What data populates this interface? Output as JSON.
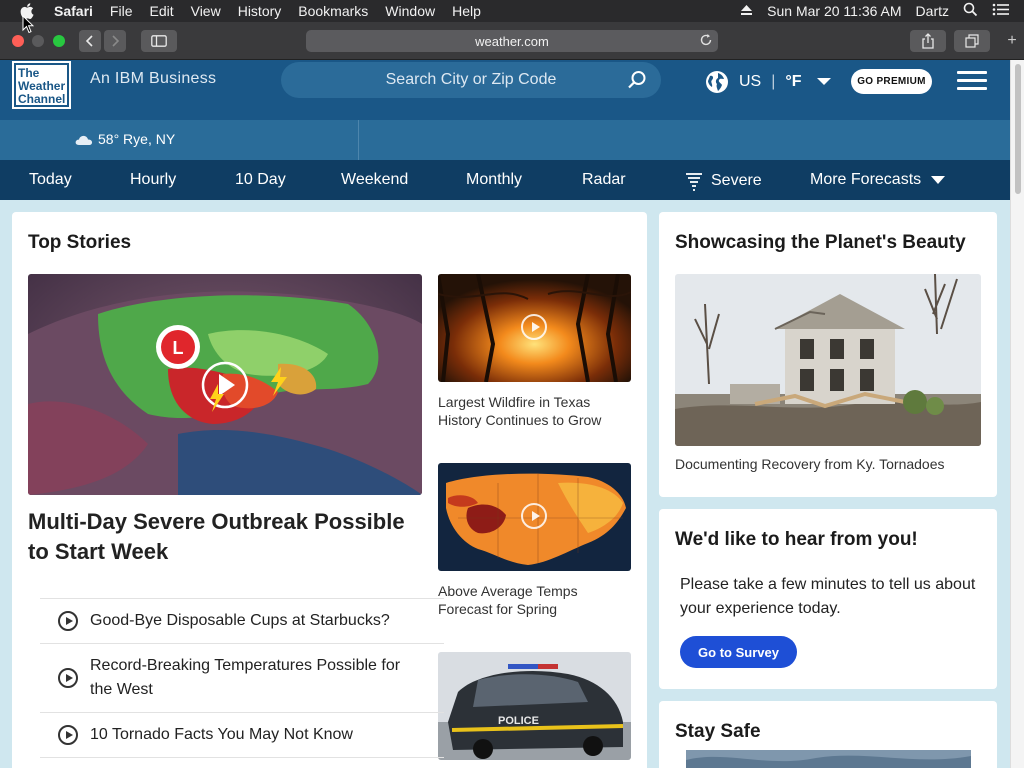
{
  "menubar": {
    "app": "Safari",
    "items": [
      "File",
      "Edit",
      "View",
      "History",
      "Bookmarks",
      "Window",
      "Help"
    ],
    "datetime": "Sun Mar 20  11:36 AM",
    "user": "Dartz"
  },
  "browser": {
    "url": "weather.com"
  },
  "header": {
    "logo_lines": [
      "The",
      "Weather",
      "Channel"
    ],
    "tagline": "An IBM Business",
    "search_placeholder": "Search City or Zip Code",
    "region": "US",
    "unit": "°F",
    "premium_label": "GO PREMIUM"
  },
  "location": {
    "temp_location": "58° Rye, NY"
  },
  "nav": {
    "tabs": [
      "Today",
      "Hourly",
      "10 Day",
      "Weekend",
      "Monthly",
      "Radar",
      "Severe",
      "More Forecasts"
    ]
  },
  "top_stories": {
    "title": "Top Stories",
    "lead_headline": "Multi-Day Severe Outbreak Possible to Start Week",
    "side_stories": [
      "Largest Wildfire in Texas History Continues to Grow",
      "Above Average Temps Forecast for Spring"
    ],
    "list": [
      "Good-Bye Disposable Cups at Starbucks?",
      "Record-Breaking Temperatures Possible for the West",
      "10 Tornado Facts You May Not Know"
    ]
  },
  "planet": {
    "title": "Showcasing the Planet's Beauty",
    "caption": "Documenting Recovery from Ky. Tornadoes"
  },
  "survey": {
    "title": "We'd like to hear from you!",
    "body": "Please take a few minutes to tell us about your experience today.",
    "button": "Go to Survey"
  },
  "stay_safe": {
    "title": "Stay Safe"
  },
  "colors": {
    "header": "#1a5787",
    "nav": "#0f3d63",
    "strip": "#2a6c99",
    "survey_button": "#1e4fd6"
  }
}
